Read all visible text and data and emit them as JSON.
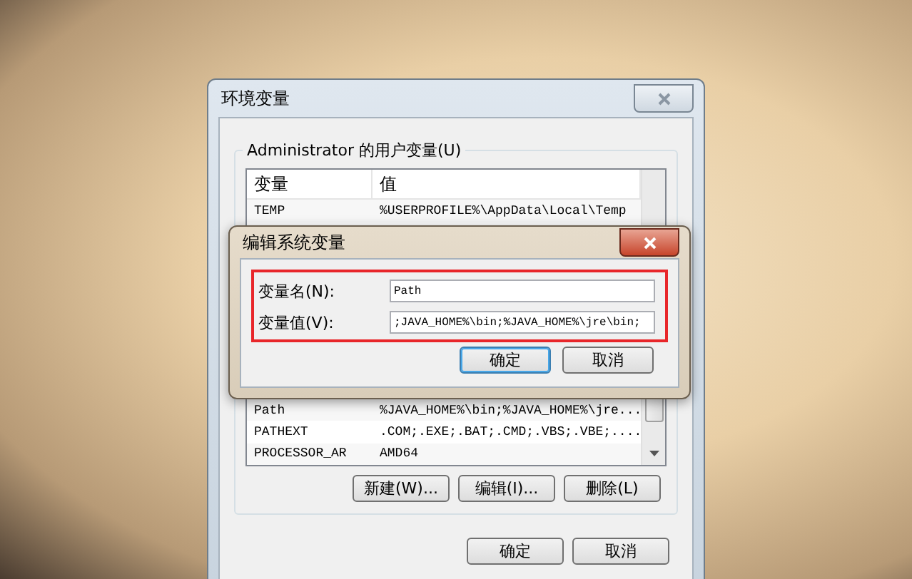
{
  "main_window": {
    "title": "环境变量",
    "user_group": {
      "label": "Administrator 的用户变量(U)",
      "columns": [
        "变量",
        "值"
      ],
      "rows": [
        {
          "name": "TEMP",
          "value": "%USERPROFILE%\\AppData\\Local\\Temp"
        }
      ]
    },
    "system_rows": [
      {
        "name": "Path",
        "value": "%JAVA_HOME%\\bin;%JAVA_HOME%\\jre..."
      },
      {
        "name": "PATHEXT",
        "value": ".COM;.EXE;.BAT;.CMD;.VBS;.VBE;...."
      },
      {
        "name": "PROCESSOR_AR",
        "value": "AMD64"
      }
    ],
    "system_buttons": [
      "新建(W)...",
      "编辑(I)...",
      "删除(L)"
    ],
    "buttons": [
      "确定",
      "取消"
    ]
  },
  "edit_dialog": {
    "title": "编辑系统变量",
    "fields": [
      {
        "label": "变量名(N):",
        "value": "Path"
      },
      {
        "label": "变量值(V):",
        "value": ";JAVA_HOME%\\bin;%JAVA_HOME%\\jre\\bin;"
      }
    ],
    "buttons": [
      {
        "label": "确定",
        "default": true
      },
      {
        "label": "取消",
        "default": false
      }
    ]
  }
}
